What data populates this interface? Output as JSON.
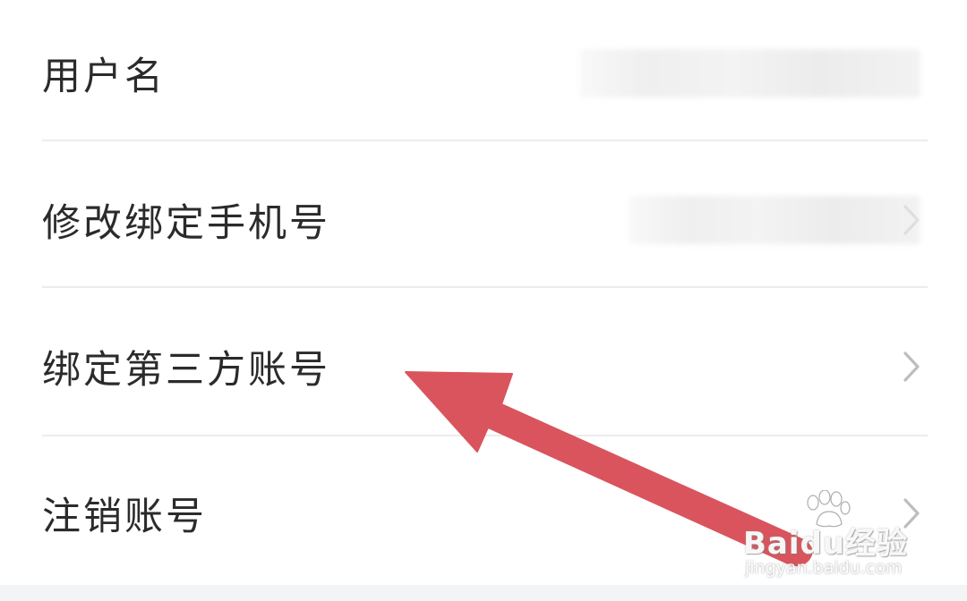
{
  "settings": {
    "rows": [
      {
        "label": "用户名",
        "has_value": true,
        "has_chevron": false
      },
      {
        "label": "修改绑定手机号",
        "has_value": true,
        "has_chevron": true
      },
      {
        "label": "绑定第三方账号",
        "has_value": false,
        "has_chevron": true
      },
      {
        "label": "注销账号",
        "has_value": false,
        "has_chevron": true
      }
    ]
  },
  "annotation": {
    "arrow_color": "#d9545d",
    "arrow_target": "绑定第三方账号"
  },
  "watermark": {
    "brand": "Baidu经验",
    "site": "jingyan.baidu.com"
  },
  "colors": {
    "text": "#2b2b2b",
    "divider": "#ececec",
    "chevron": "#bdbdbd",
    "background": "#ffffff"
  },
  "icons": [
    "chevron-right-icon",
    "baidu-paw-icon"
  ]
}
